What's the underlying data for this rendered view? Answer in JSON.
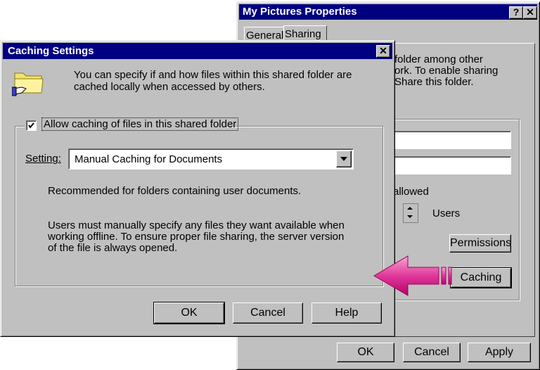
{
  "bg_window": {
    "title": "My Pictures Properties",
    "help_button": "?",
    "close_button": "✕",
    "tabs": [
      "General",
      "Sharing"
    ],
    "partial_lines": [
      "folder among other",
      "ork.  To enable sharing",
      "Share this folder."
    ],
    "allowed_label": "allowed",
    "users_label": "Users",
    "permissions_button": "Permissions",
    "caching_button": "Caching",
    "ok_button": "OK",
    "cancel_button": "Cancel",
    "apply_button": "Apply"
  },
  "dialog": {
    "title": "Caching Settings",
    "close_button": "✕",
    "intro_line1": "You can specify if and how files within this shared folder are",
    "intro_line2": "cached locally when accessed by others.",
    "checkbox_label": "Allow caching of files in this shared folder",
    "checkbox_checked": true,
    "setting_label": "Setting:",
    "setting_value": "Manual Caching for Documents",
    "recommended": "Recommended for folders containing user documents.",
    "desc_line1": "Users must manually specify any files they want available when",
    "desc_line2": "working offline.  To ensure proper file sharing, the server version",
    "desc_line3": "of the file is always opened.",
    "ok_button": "OK",
    "cancel_button": "Cancel",
    "help_button": "Help"
  },
  "colors": {
    "titlebar": "#000080",
    "face": "#c0c0c0",
    "arrow": "#e0389a"
  },
  "icons": {
    "folder": "folder-hand-icon",
    "arrow": "pointer-arrow-icon"
  }
}
